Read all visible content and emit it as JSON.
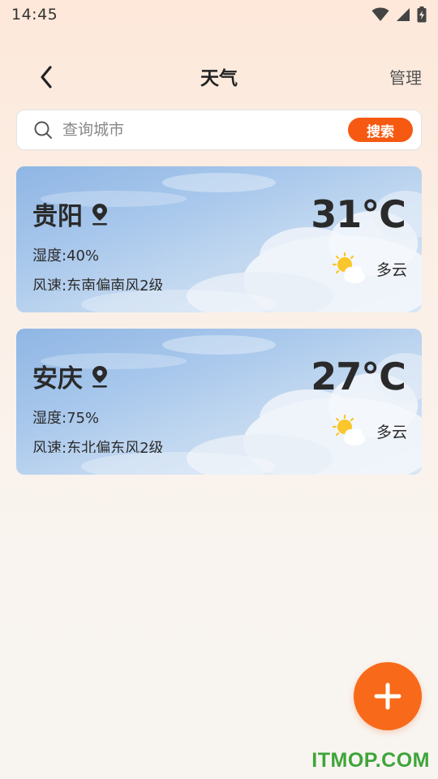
{
  "status_bar": {
    "time": "14:45"
  },
  "header": {
    "title": "天气",
    "manage_label": "管理"
  },
  "search": {
    "placeholder": "查询城市",
    "value": "",
    "button_label": "搜索"
  },
  "cities": [
    {
      "name": "贵阳",
      "humidity_label": "湿度:",
      "humidity_value": "40%",
      "wind_label": "风速:",
      "wind_value": "东南偏南风2级",
      "temperature": "31℃",
      "condition": "多云",
      "condition_icon": "partly-cloudy-icon"
    },
    {
      "name": "安庆",
      "humidity_label": "湿度:",
      "humidity_value": "75%",
      "wind_label": "风速:",
      "wind_value": "东北偏东风2级",
      "temperature": "27℃",
      "condition": "多云",
      "condition_icon": "partly-cloudy-icon"
    }
  ],
  "fab": {
    "icon": "plus-icon"
  },
  "watermark": {
    "text": "ITMOP.COM"
  },
  "colors": {
    "accent": "#f65a12",
    "fab": "#f86a1a",
    "watermark": "#3fa53a"
  }
}
